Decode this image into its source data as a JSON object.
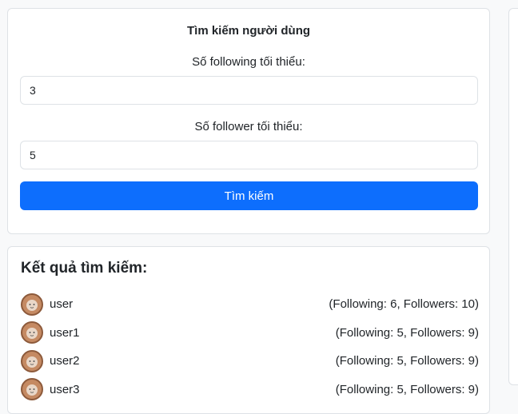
{
  "search": {
    "title": "Tìm kiếm người dùng",
    "following_label": "Số following tối thiểu:",
    "following_value": "3",
    "follower_label": "Số follower tối thiểu:",
    "follower_value": "5",
    "button_label": "Tìm kiếm"
  },
  "results": {
    "title": "Kết quả tìm kiếm:",
    "items": [
      {
        "username": "user",
        "stats": "(Following: 6, Followers: 10)"
      },
      {
        "username": "user1",
        "stats": "(Following: 5, Followers: 9)"
      },
      {
        "username": "user2",
        "stats": "(Following: 5, Followers: 9)"
      },
      {
        "username": "user3",
        "stats": "(Following: 5, Followers: 9)"
      }
    ]
  },
  "icons": {
    "avatar": "avatar-icon"
  },
  "colors": {
    "primary": "#0d6efd",
    "border": "#dee2e6",
    "background": "#f8f9fa"
  }
}
